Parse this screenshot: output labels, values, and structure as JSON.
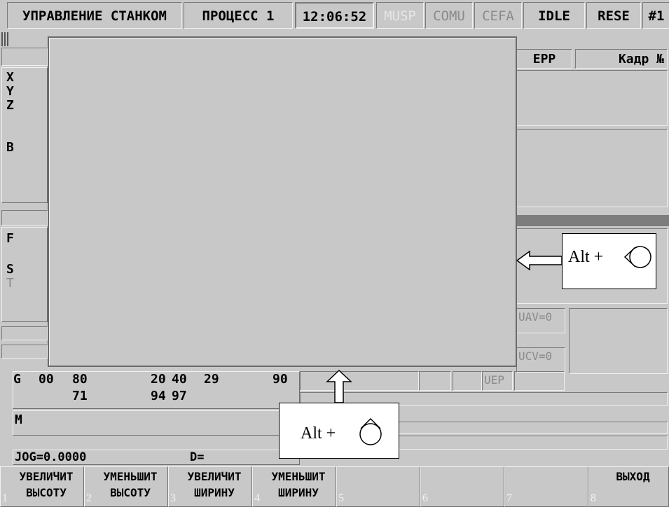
{
  "header": {
    "title": "УПРАВЛЕНИЕ СТАНКОМ",
    "process": "ПРОЦЕСС 1",
    "time": "12:06:52",
    "status": [
      "MUSP",
      "COMU",
      "CEFA",
      "IDLE",
      "RESE",
      "#1"
    ]
  },
  "top_right": {
    "epp": "EPP",
    "frame": "Кадр №"
  },
  "axes": [
    "X",
    "Y",
    "Z",
    "",
    "B"
  ],
  "feed_labels": [
    "F",
    "",
    "S",
    "T"
  ],
  "uav": "UAV=0",
  "ucv": "UCV=0",
  "uep": "UEP",
  "g_codes": {
    "label": "G",
    "row1": [
      "00",
      "80",
      "20",
      "40",
      "29",
      "90"
    ],
    "row2": [
      "71",
      "94",
      "97"
    ]
  },
  "m_label": "M",
  "jog": "JOG=0.0000",
  "d_label": "D=",
  "callouts": {
    "right": "Alt + ",
    "bottom": "Alt + "
  },
  "function_keys": [
    {
      "num": "1",
      "line1": "УВЕЛИЧИТ",
      "line2": "ВЫСОТУ"
    },
    {
      "num": "2",
      "line1": "УМЕНЬШИТ",
      "line2": "ВЫСОТУ"
    },
    {
      "num": "3",
      "line1": "УВЕЛИЧИТ",
      "line2": "ШИРИНУ"
    },
    {
      "num": "4",
      "line1": "УМЕНЬШИТ",
      "line2": "ШИРИНУ"
    },
    {
      "num": "5",
      "line1": "",
      "line2": ""
    },
    {
      "num": "6",
      "line1": "",
      "line2": ""
    },
    {
      "num": "7",
      "line1": "",
      "line2": ""
    },
    {
      "num": "8",
      "line1": "ВЫХОД",
      "line2": ""
    }
  ],
  "colors": {
    "panel": "#c8c8c8",
    "dark_bar": "#7d7d7d",
    "callout_bg": "#ffffff"
  }
}
